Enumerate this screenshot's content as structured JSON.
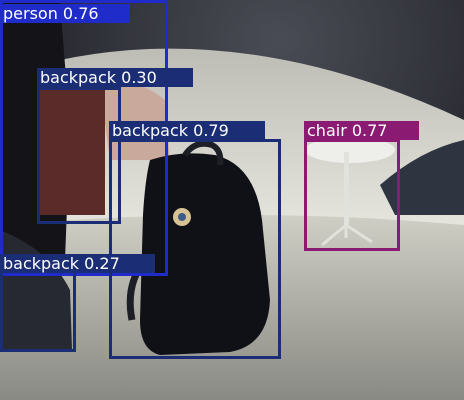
{
  "detections": [
    {
      "label": "person 0.76",
      "color": "#1f2cc9"
    },
    {
      "label": "backpack 0.30",
      "color": "#1b2d75"
    },
    {
      "label": "backpack 0.79",
      "color": "#1b2d75"
    },
    {
      "label": "chair 0.77",
      "color": "#8a1a72"
    },
    {
      "label": "backpack 0.27",
      "color": "#1b2d75"
    }
  ]
}
